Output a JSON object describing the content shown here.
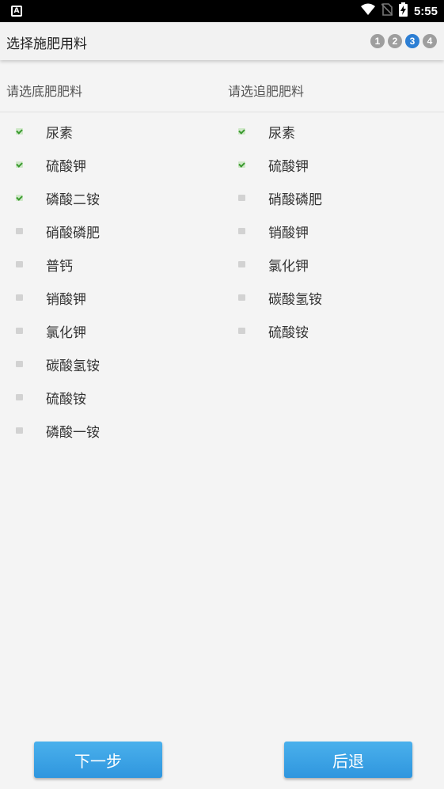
{
  "status_bar": {
    "time": "5:55",
    "notification_icon_letter": "A"
  },
  "app_bar": {
    "title": "选择施肥用料",
    "steps": [
      {
        "label": "1",
        "active": false
      },
      {
        "label": "2",
        "active": false
      },
      {
        "label": "3",
        "active": true
      },
      {
        "label": "4",
        "active": false
      }
    ]
  },
  "base_fertilizer": {
    "header": "请选底肥肥料",
    "items": [
      {
        "label": "尿素",
        "checked": true
      },
      {
        "label": "硫酸钾",
        "checked": true
      },
      {
        "label": "磷酸二铵",
        "checked": true
      },
      {
        "label": "硝酸磷肥",
        "checked": false
      },
      {
        "label": "普钙",
        "checked": false
      },
      {
        "label": "销酸钾",
        "checked": false
      },
      {
        "label": "氯化钾",
        "checked": false
      },
      {
        "label": "碳酸氢铵",
        "checked": false
      },
      {
        "label": "硫酸铵",
        "checked": false
      },
      {
        "label": "磷酸一铵",
        "checked": false
      }
    ]
  },
  "top_fertilizer": {
    "header": "请选追肥肥料",
    "items": [
      {
        "label": "尿素",
        "checked": true
      },
      {
        "label": "硫酸钾",
        "checked": true
      },
      {
        "label": "硝酸磷肥",
        "checked": false
      },
      {
        "label": "销酸钾",
        "checked": false
      },
      {
        "label": "氯化钾",
        "checked": false
      },
      {
        "label": "碳酸氢铵",
        "checked": false
      },
      {
        "label": "硫酸铵",
        "checked": false
      }
    ]
  },
  "buttons": {
    "next": "下一步",
    "back": "后退"
  },
  "colors": {
    "accent": "#2d7fd4",
    "button": "#3aa3e6",
    "checked": "#3a9a2f"
  }
}
